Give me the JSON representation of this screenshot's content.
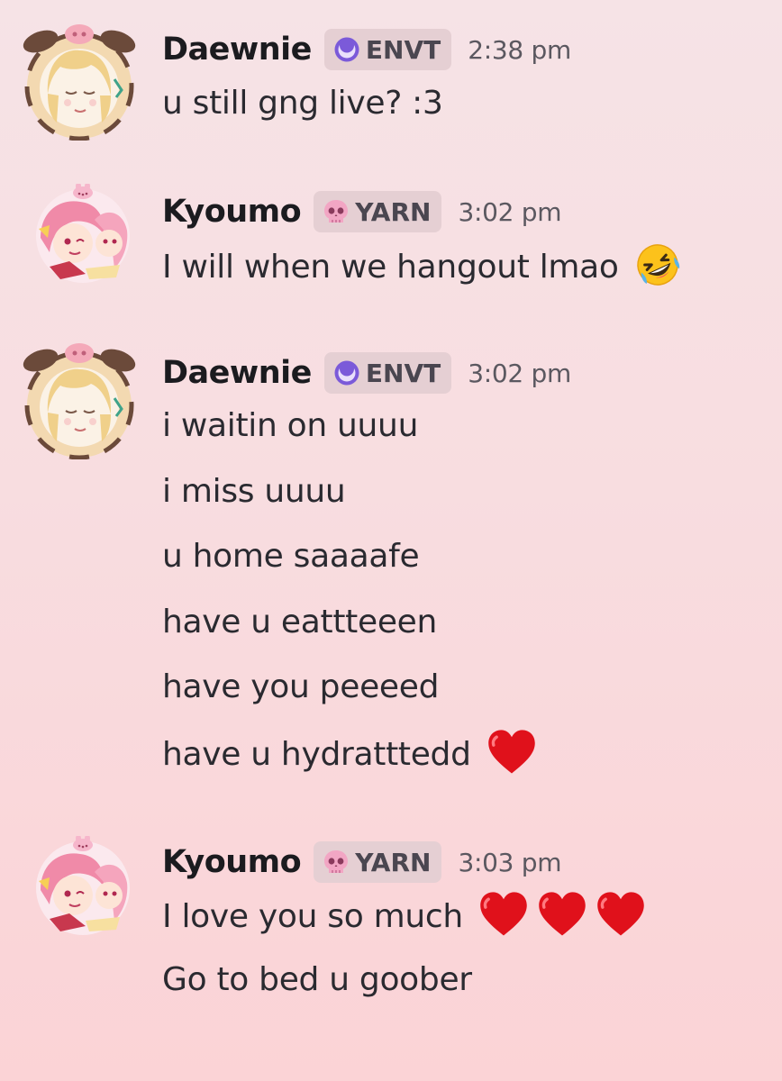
{
  "messages": [
    {
      "author": "Daewnie",
      "tag": "ENVT",
      "tag_icon": "crescent-moon-icon",
      "time": "2:38 pm",
      "lines": [
        "u still gng live? :3"
      ]
    },
    {
      "author": "Kyoumo",
      "tag": "YARN",
      "tag_icon": "pink-skull-icon",
      "time": "3:02 pm",
      "lines": [
        "I will when we hangout lmao"
      ],
      "emoji": "rolling-on-floor-laughing-emoji"
    },
    {
      "author": "Daewnie",
      "tag": "ENVT",
      "tag_icon": "crescent-moon-icon",
      "time": "3:02 pm",
      "lines": [
        "i waitin on uuuu",
        "i miss uuuu",
        "u home saaaafe",
        "have u eattteeen",
        "have you peeeed",
        "have u hydratttedd"
      ],
      "emoji": "red-heart-emoji"
    },
    {
      "author": "Kyoumo",
      "tag": "YARN",
      "tag_icon": "pink-skull-icon",
      "time": "3:03 pm",
      "lines": [
        "I love you so much",
        "Go to bed u goober"
      ],
      "emoji": "red-heart-emoji"
    }
  ],
  "colors": {
    "background_top": "#f6e3e6",
    "background_bottom": "#fbd3d6",
    "tag_background": "#e5cfd3",
    "username": "#1b1b1f",
    "timestamp": "#5b5860",
    "heart": "#e0111b"
  }
}
